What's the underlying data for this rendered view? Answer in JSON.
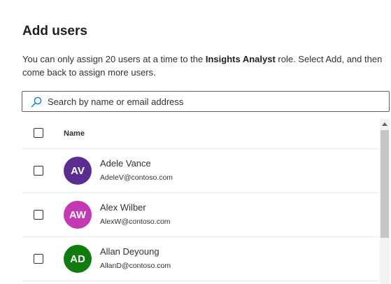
{
  "panel": {
    "title": "Add users",
    "description_part1": "You can only assign 20 users at a time to the ",
    "role_name": "Insights Analyst",
    "description_part2": " role. Select Add, and then come back to assign more users."
  },
  "search": {
    "placeholder": "Search by name or email address",
    "icon": "search-icon"
  },
  "table": {
    "columns": [
      "Name"
    ],
    "rows": [
      {
        "initials": "AV",
        "name": "Adele Vance",
        "email": "AdeleV@contoso.com",
        "avatar_color": "#5c2d91",
        "checked": false
      },
      {
        "initials": "AW",
        "name": "Alex Wilber",
        "email": "AlexW@contoso.com",
        "avatar_color": "#c239b3",
        "checked": false
      },
      {
        "initials": "AD",
        "name": "Allan Deyoung",
        "email": "AllanD@contoso.com",
        "avatar_color": "#107c10",
        "checked": false
      }
    ]
  },
  "colors": {
    "text": "#323130",
    "border": "#605e5c",
    "divider": "#edebe9",
    "scroll_thumb": "#c8c6c4"
  }
}
